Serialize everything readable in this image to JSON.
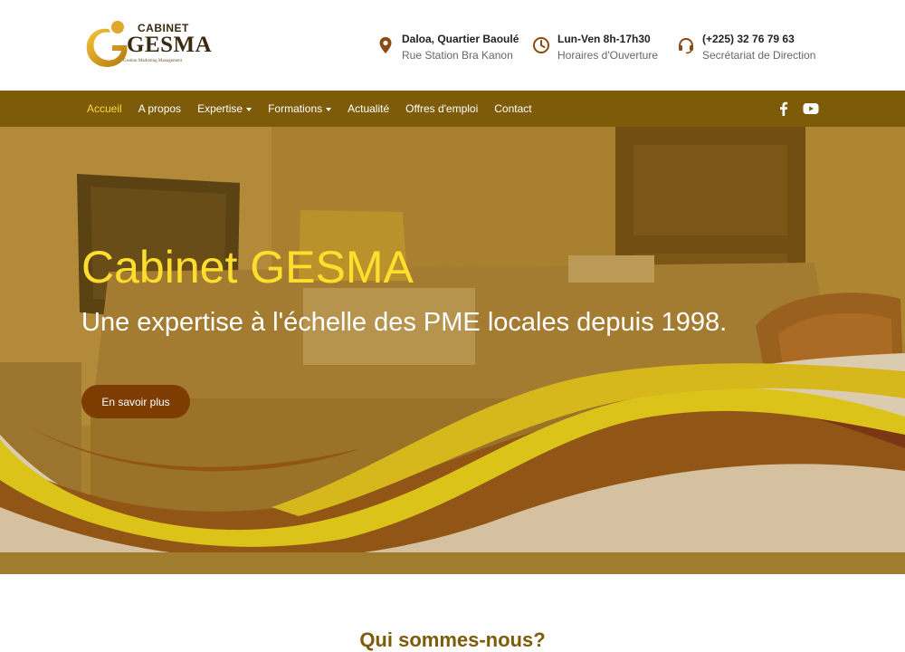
{
  "logo": {
    "cabinet": "CABINET",
    "gesma": "GESMA",
    "tagline": "Gestion Marketing Management"
  },
  "contact": {
    "address": {
      "line1": "Daloa, Quartier Baoulé",
      "line2": "Rue Station Bra Kanon",
      "icon": "map-pin-icon"
    },
    "hours": {
      "line1": "Lun-Ven 8h-17h30",
      "line2": "Horaires d'Ouverture",
      "icon": "clock-icon"
    },
    "phone": {
      "line1": "(+225) 32 76 79 63",
      "line2": "Secrétariat de Direction",
      "icon": "headset-icon"
    }
  },
  "nav": {
    "items": [
      {
        "label": "Accueil",
        "active": true,
        "dropdown": false
      },
      {
        "label": "A propos",
        "active": false,
        "dropdown": false
      },
      {
        "label": "Expertise",
        "active": false,
        "dropdown": true
      },
      {
        "label": "Formations",
        "active": false,
        "dropdown": true
      },
      {
        "label": "Actualité",
        "active": false,
        "dropdown": false
      },
      {
        "label": "Offres d'emploi",
        "active": false,
        "dropdown": false
      },
      {
        "label": "Contact",
        "active": false,
        "dropdown": false
      }
    ],
    "social": [
      "facebook-icon",
      "youtube-icon"
    ]
  },
  "hero": {
    "title": "Cabinet GESMA",
    "subtitle": "Une expertise à l'échelle des PME locales depuis 1998.",
    "button_label": "En savoir plus"
  },
  "section": {
    "title": "Qui sommes-nous?"
  },
  "colors": {
    "brand_brown": "#7d5b08",
    "accent_yellow": "#ffde2e",
    "button_brown": "#7d3c02",
    "icon_brown": "#8a4a12"
  }
}
